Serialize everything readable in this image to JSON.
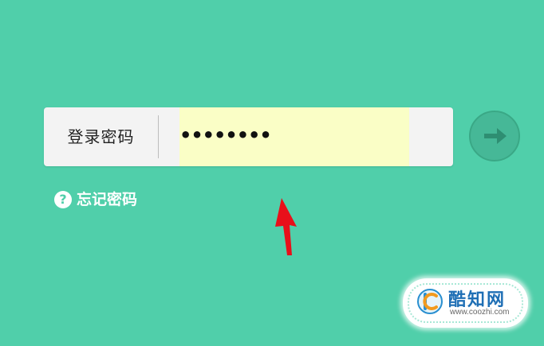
{
  "login": {
    "label": "登录密码",
    "password_value": "••••••••"
  },
  "forgot": {
    "label": "忘记密码",
    "icon_glyph": "?",
    "icon": "help-icon"
  },
  "submit": {
    "icon": "arrow-right-icon"
  },
  "watermark": {
    "name": "酷知网",
    "url": "www.coozhi.com"
  },
  "colors": {
    "background": "#50cfaa",
    "input_fill": "#fafec6",
    "button": "#46b897",
    "annotation_arrow": "#e8101a",
    "watermark_text": "#1f6fb5"
  }
}
